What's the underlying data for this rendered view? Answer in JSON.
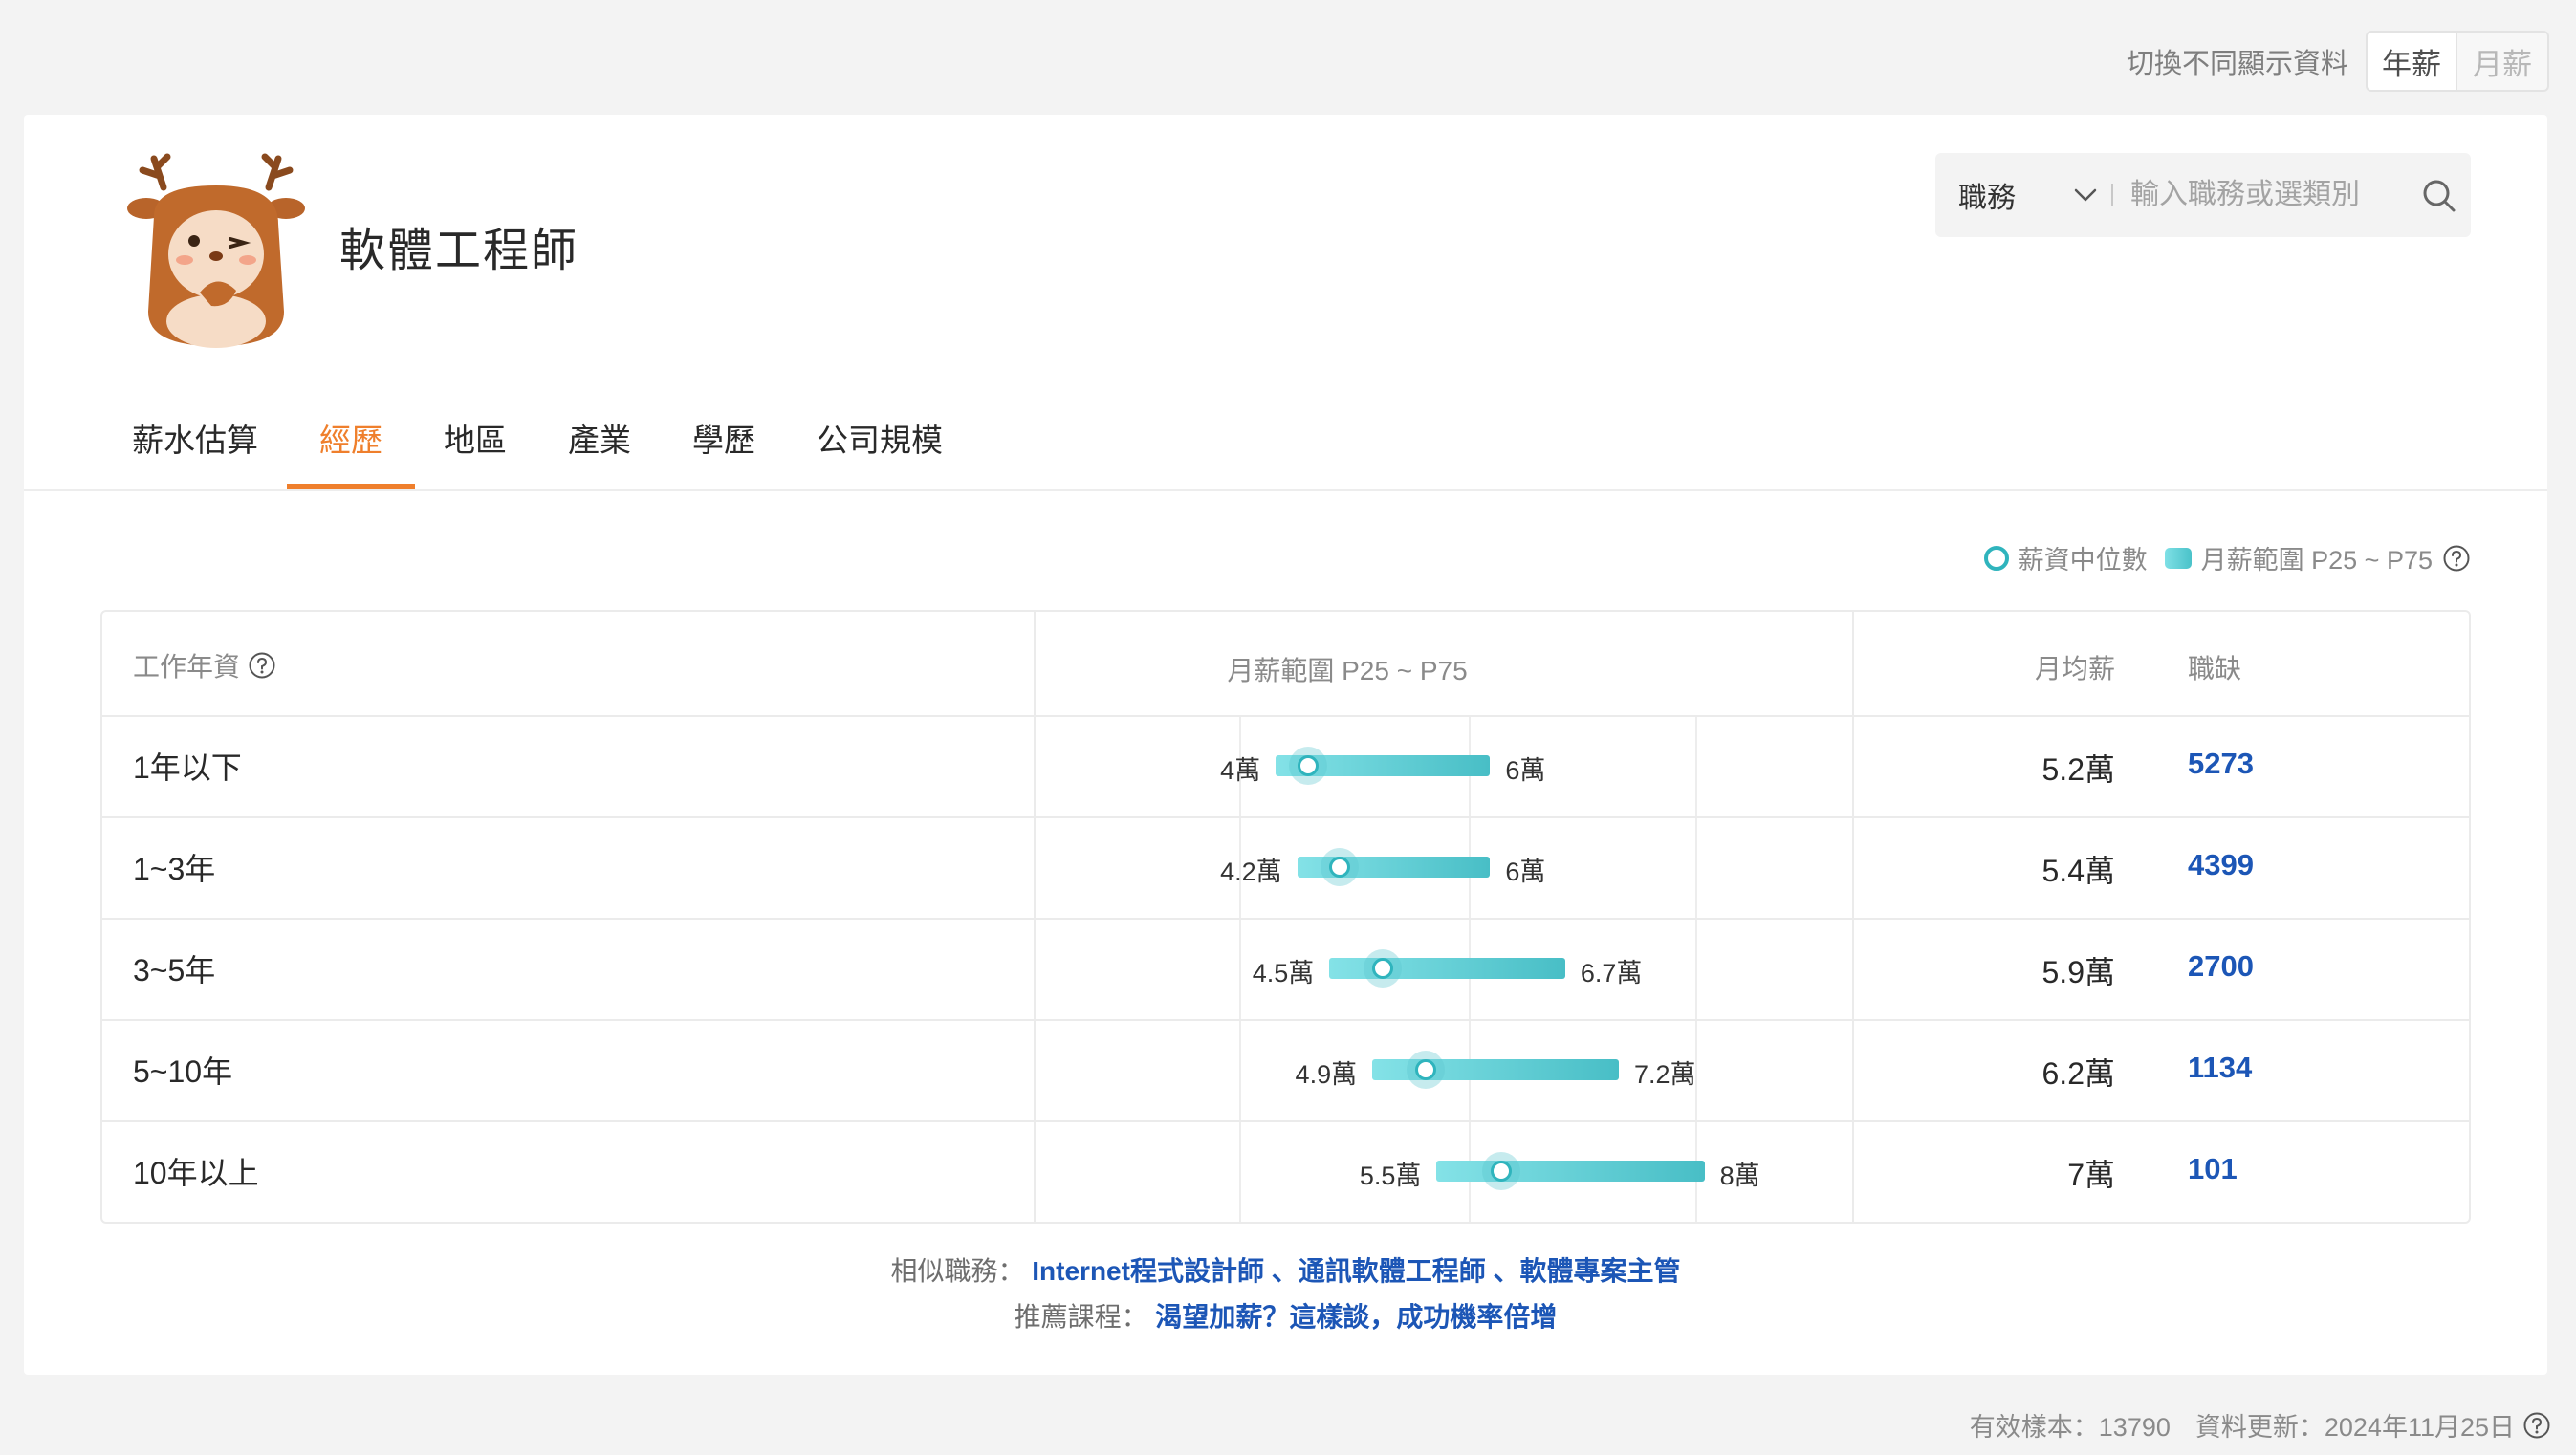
{
  "toggle": {
    "label": "切換不同顯示資料",
    "options": [
      "年薪",
      "月薪"
    ],
    "active": "年薪"
  },
  "header": {
    "title": "軟體工程師"
  },
  "search": {
    "category": "職務",
    "placeholder": "輸入職務或選類別"
  },
  "tabs": [
    {
      "label": "薪水估算"
    },
    {
      "label": "經歷",
      "active": true
    },
    {
      "label": "地區"
    },
    {
      "label": "產業"
    },
    {
      "label": "學歷"
    },
    {
      "label": "公司規模"
    }
  ],
  "legend": {
    "median": "薪資中位數",
    "range": "月薪範圍 P25 ~ P75"
  },
  "table": {
    "headers": {
      "experience": "工作年資",
      "range": "月薪範圍 P25 ~ P75",
      "avg": "月均薪",
      "jobs": "職缺"
    },
    "rows": [
      {
        "label": "1年以下",
        "p25": 4.0,
        "median": 4.3,
        "p75": 6.0,
        "p25_label": "4萬",
        "p75_label": "6萬",
        "avg": "5.2萬",
        "jobs": "5273"
      },
      {
        "label": "1~3年",
        "p25": 4.2,
        "median": 4.6,
        "p75": 6.0,
        "p25_label": "4.2萬",
        "p75_label": "6萬",
        "avg": "5.4萬",
        "jobs": "4399"
      },
      {
        "label": "3~5年",
        "p25": 4.5,
        "median": 5.0,
        "p75": 6.7,
        "p25_label": "4.5萬",
        "p75_label": "6.7萬",
        "avg": "5.9萬",
        "jobs": "2700"
      },
      {
        "label": "5~10年",
        "p25": 4.9,
        "median": 5.4,
        "p75": 7.2,
        "p25_label": "4.9萬",
        "p75_label": "7.2萬",
        "avg": "6.2萬",
        "jobs": "1134"
      },
      {
        "label": "10年以上",
        "p25": 5.5,
        "median": 6.1,
        "p75": 8.0,
        "p25_label": "5.5萬",
        "p75_label": "8萬",
        "avg": "7萬",
        "jobs": "101"
      }
    ]
  },
  "similar": {
    "label": "相似職務：",
    "links": "Internet程式設計師 、通訊軟體工程師 、軟體專案主管"
  },
  "course": {
    "label": "推薦課程：",
    "link": "渴望加薪？這樣談，成功機率倍增"
  },
  "footer": {
    "samples": "有效樣本：13790",
    "updated": "資料更新：2024年11月25日"
  },
  "colors": {
    "accent": "#ef7f2c",
    "link": "#1c56b6",
    "teal": "#2fb4bd"
  }
}
